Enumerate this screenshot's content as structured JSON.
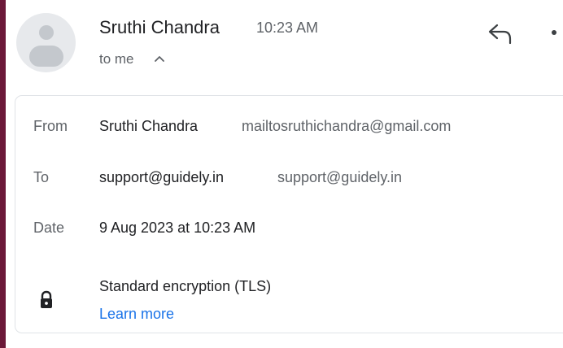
{
  "header": {
    "sender_name": "Sruthi Chandra",
    "time": "10:23 AM",
    "recipient_summary": "to me",
    "avatar_icon": "person-avatar-icon",
    "reply_icon": "reply-icon",
    "more_icon": "more-vertical-icon",
    "toggle_icon": "chevron-up-icon"
  },
  "details": {
    "from": {
      "label": "From",
      "name": "Sruthi Chandra",
      "email": "mailtosruthichandra@gmail.com"
    },
    "to": {
      "label": "To",
      "name": "support@guidely.in",
      "email": "support@guidely.in"
    },
    "date": {
      "label": "Date",
      "value": "9 Aug 2023 at 10:23 AM"
    },
    "security": {
      "icon": "lock-icon",
      "value": "Standard encryption (TLS)",
      "link": "Learn more"
    }
  },
  "colors": {
    "accent_edge": "#6b1838",
    "link": "#1a73e8",
    "secondary_text": "#5f6368",
    "primary_text": "#202124"
  }
}
